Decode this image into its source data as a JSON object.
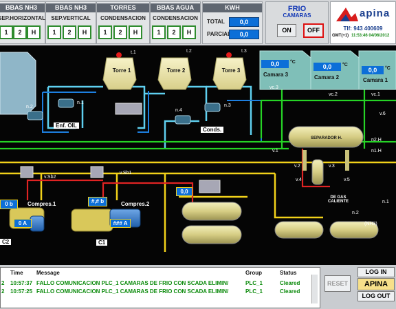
{
  "topbar": {
    "groups": [
      {
        "title": "BBAS NH3",
        "sub": "SEP.HORIZONTAL",
        "btns": [
          "1",
          "2",
          "H"
        ]
      },
      {
        "title": "BBAS NH3",
        "sub": "SEP.VERTICAL",
        "btns": [
          "1",
          "2",
          "H"
        ]
      },
      {
        "title": "TORRES",
        "sub": "CONDENSACION",
        "btns": [
          "1",
          "2",
          "H"
        ]
      },
      {
        "title": "BBAS AGUA",
        "sub": "CONDENSACION",
        "btns": [
          "1",
          "2",
          "H"
        ]
      }
    ],
    "kwh": {
      "title": "KWH",
      "total_label": "TOTAL",
      "total_value": "0,0",
      "parcial_label": "PARCIAL",
      "parcial_value": "0,0"
    },
    "frio": {
      "title": "FRIO",
      "subtitle": "CAMARAS",
      "on_label": "ON",
      "off_label": "OFF"
    },
    "logo": {
      "name": "apina",
      "phone": "Tlf: 943 400609",
      "clock_prefix": "GMT(+1)",
      "clock": "11:53:46 04/06/2012"
    }
  },
  "plant": {
    "towers": [
      {
        "label": "Torre 1",
        "tag": "t.1"
      },
      {
        "label": "Torre 2",
        "tag": "t.2"
      },
      {
        "label": "Torre 3",
        "tag": "t.3"
      }
    ],
    "cameras": [
      {
        "label": "Camara 3",
        "temp": "0,0",
        "unit": "°C"
      },
      {
        "label": "Camara 2",
        "temp": "0,0",
        "unit": "°C"
      },
      {
        "label": "Camara 1",
        "temp": "0,0",
        "unit": "°C"
      }
    ],
    "pumps": {
      "n1": "n.1",
      "n2": "n.2",
      "n3": "n.3",
      "n4": "n.4"
    },
    "boxes": {
      "enf_oil": "Enf. OIL",
      "conds": "Conds."
    },
    "valves": {
      "vc3": "vc.3",
      "vc2": "vc.2",
      "vc1": "vc.1",
      "v6": "v.6",
      "v1": "v.1",
      "v2": "v.2",
      "v3": "v.3",
      "v4": "v.4",
      "v5": "v.5",
      "vsb2": "v.Sb2",
      "vsb1": "v.Sb1",
      "n2h": "n2.H",
      "n1h": "n1.H",
      "n1": "n.1",
      "n2b": "n.2"
    },
    "separator": "SEPARADOR H.",
    "gas_caliente": "DE GAS CALIENTE",
    "nh3": "(NH3)",
    "value_00": "0,0",
    "compressors": [
      {
        "label": "Compres.1",
        "val_b": "0 b",
        "val_a": "0 A",
        "c": "C2"
      },
      {
        "label": "Compres.2",
        "val_b": "#,# b",
        "val_a": "### A",
        "c": "C1"
      }
    ]
  },
  "alarms": {
    "headers": {
      "time": "Time",
      "message": "Message",
      "group": "Group",
      "status": "Status"
    },
    "rows": [
      {
        "idx": "2",
        "time": "10:57:37",
        "message": "FALLO COMUNICACION PLC_1 CAMARAS DE FRIO  CON SCADA ELIMIN/",
        "group": "PLC_1",
        "status": "Cleared"
      },
      {
        "idx": "2",
        "time": "10:57:25",
        "message": "FALLO COMUNICACION PLC_1 CAMARAS DE FRIO  CON SCADA ELIMIN/",
        "group": "PLC_1",
        "status": "Cleared"
      }
    ],
    "reset_label": "RESET",
    "login_label": "LOG IN",
    "user_label": "APINA",
    "logout_label": "LOG OUT"
  }
}
